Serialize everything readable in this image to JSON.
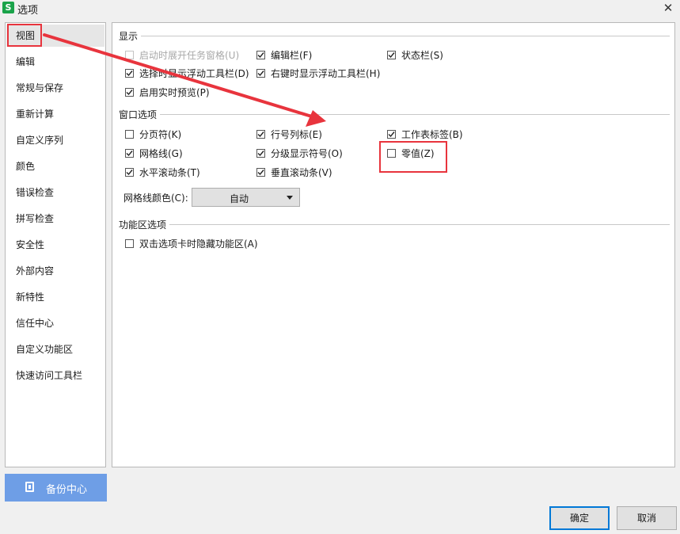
{
  "window": {
    "title": "选项",
    "app_icon_letter": "S",
    "close_symbol": "✕"
  },
  "sidebar": {
    "items": [
      {
        "label": "视图",
        "active": true
      },
      {
        "label": "编辑"
      },
      {
        "label": "常规与保存"
      },
      {
        "label": "重新计算"
      },
      {
        "label": "自定义序列"
      },
      {
        "label": "颜色"
      },
      {
        "label": "错误检查"
      },
      {
        "label": "拼写检查"
      },
      {
        "label": "安全性"
      },
      {
        "label": "外部内容"
      },
      {
        "label": "新特性"
      },
      {
        "label": "信任中心"
      },
      {
        "label": "自定义功能区"
      },
      {
        "label": "快速访问工具栏"
      }
    ],
    "backup_label": "备份中心"
  },
  "display": {
    "title": "显示",
    "options": [
      {
        "label": "启动时展开任务窗格(U)",
        "checked": false,
        "disabled": true
      },
      {
        "label": "编辑栏(F)",
        "checked": true
      },
      {
        "label": "状态栏(S)",
        "checked": true
      },
      {
        "label": "选择时显示浮动工具栏(D)",
        "checked": true
      },
      {
        "label": "右键时显示浮动工具栏(H)",
        "checked": true
      },
      {
        "label": "启用实时预览(P)",
        "checked": true
      }
    ]
  },
  "window_options": {
    "title": "窗口选项",
    "options": [
      {
        "label": "分页符(K)",
        "checked": false
      },
      {
        "label": "行号列标(E)",
        "checked": true
      },
      {
        "label": "工作表标签(B)",
        "checked": true
      },
      {
        "label": "网格线(G)",
        "checked": true
      },
      {
        "label": "分级显示符号(O)",
        "checked": true
      },
      {
        "label": "零值(Z)",
        "checked": false
      },
      {
        "label": "水平滚动条(T)",
        "checked": true
      },
      {
        "label": "垂直滚动条(V)",
        "checked": true
      }
    ],
    "gridline_color_label": "网格线颜色(C):",
    "gridline_color_value": "自动"
  },
  "ribbon_options": {
    "title": "功能区选项",
    "options": [
      {
        "label": "双击选项卡时隐藏功能区(A)",
        "checked": false
      }
    ]
  },
  "buttons": {
    "ok": "确定",
    "cancel": "取消"
  },
  "colors": {
    "accent_blue": "#0078d7",
    "backup_blue": "#6e9ee6",
    "annotation_red": "#e8343d",
    "app_green": "#1aa34a"
  }
}
